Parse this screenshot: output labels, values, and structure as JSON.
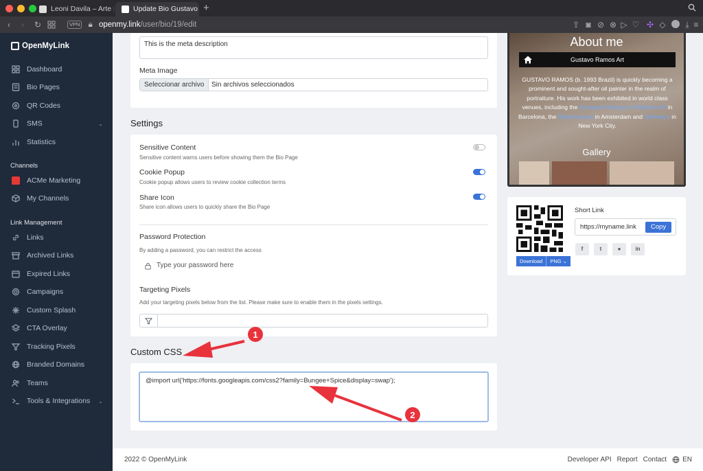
{
  "browser": {
    "tabs": [
      {
        "title": "Leoni Davila – Arte Leoni Davila",
        "active": false
      },
      {
        "title": "Update Bio Gustavo Ramos – O",
        "active": true
      }
    ],
    "vpn_label": "VPN",
    "url_host": "openmy.link",
    "url_path": "/user/bio/19/edit"
  },
  "sidebar": {
    "brand": "OpenMyLink",
    "items": [
      {
        "label": "Dashboard",
        "icon": "dashboard-icon"
      },
      {
        "label": "Bio Pages",
        "icon": "bio-pages-icon"
      },
      {
        "label": "QR Codes",
        "icon": "qr-icon"
      },
      {
        "label": "SMS",
        "icon": "phone-icon"
      },
      {
        "label": "Statistics",
        "icon": "chart-icon"
      }
    ],
    "channels_heading": "Channels",
    "channels": [
      {
        "label": "ACMe Marketing"
      },
      {
        "label": "My Channels"
      }
    ],
    "link_heading": "Link Management",
    "link_items": [
      {
        "label": "Links"
      },
      {
        "label": "Archived Links"
      },
      {
        "label": "Expired Links"
      },
      {
        "label": "Campaigns"
      },
      {
        "label": "Custom Splash"
      },
      {
        "label": "CTA Overlay"
      },
      {
        "label": "Tracking Pixels"
      },
      {
        "label": "Branded Domains"
      },
      {
        "label": "Teams"
      },
      {
        "label": "Tools & Integrations"
      }
    ]
  },
  "meta": {
    "description_value": "This is the meta description",
    "image_label": "Meta Image",
    "file_button": "Seleccionar archivo",
    "file_status": "Sin archivos seleccionados"
  },
  "settings": {
    "title": "Settings",
    "sensitive": {
      "label": "Sensitive Content",
      "help": "Sensitive content warns users before showing them the Bio Page",
      "on": false
    },
    "cookie": {
      "label": "Cookie Popup",
      "help": "Cookie popup allows users to review cookie collection terms",
      "on": true
    },
    "share": {
      "label": "Share Icon",
      "help": "Share icon allows users to quickly share the Bio Page",
      "on": true
    },
    "password": {
      "label": "Password Protection",
      "help": "By adding a password, you can restrict the access",
      "placeholder": "Type your password here"
    },
    "pixels": {
      "label": "Targeting Pixels",
      "help": "Add your targeting pixels below from the list. Please make sure to enable them in the pixels settings."
    }
  },
  "custom_css": {
    "title": "Custom CSS",
    "value": "@import url('https://fonts.googleapis.com/css2?family=Bungee+Spice&display=swap');"
  },
  "annotations": {
    "one": "1",
    "two": "2",
    "color": "#e8323c"
  },
  "preview": {
    "heading": "About me",
    "name": "Gustavo Ramos Art",
    "bio_1": "GUSTAVO RAMOS (b. 1993 Brazil) is quickly becoming a prominent and sought-after oil painter in the realm of portraiture. His work has been exhibited in world class venues, including the ",
    "bio_link_1": "European Museum of Modern Art",
    "bio_2": " in Barcelona, the ",
    "bio_link_2": "Rijksmuseum",
    "bio_3": " in Amsterdam and ",
    "bio_link_3": "Sotheby's",
    "bio_4": " in New York City.",
    "gallery": "Gallery"
  },
  "short_link": {
    "label": "Short Link",
    "value": "https://myname.link",
    "copy": "Copy",
    "download": "Download",
    "format": "PNG",
    "share_icons": [
      "facebook-icon",
      "twitter-icon",
      "reddit-icon",
      "linkedin-icon"
    ]
  },
  "footer": {
    "copyright": "2022 © OpenMyLink",
    "links": [
      "Developer API",
      "Report",
      "Contact"
    ],
    "lang": "EN"
  },
  "colors": {
    "accent": "#3b73d6",
    "sidebar": "#1f2a3a",
    "annotation": "#e8323c"
  }
}
